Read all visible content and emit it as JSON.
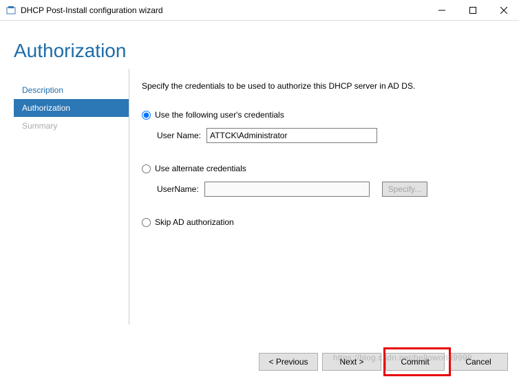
{
  "titlebar": {
    "title": "DHCP Post-Install configuration wizard"
  },
  "header": {
    "title": "Authorization"
  },
  "sidebar": {
    "items": [
      {
        "label": "Description"
      },
      {
        "label": "Authorization"
      },
      {
        "label": "Summary"
      }
    ]
  },
  "content": {
    "instruction": "Specify the credentials to be used to authorize this DHCP server in AD DS.",
    "option1": {
      "label": "Use the following user's credentials",
      "field_label": "User Name:",
      "field_value": "ATTCK\\Administrator"
    },
    "option2": {
      "label": "Use alternate credentials",
      "field_label": "UserName:",
      "field_value": "",
      "specify_btn": "Specify..."
    },
    "option3": {
      "label": "Skip AD authorization"
    }
  },
  "footer": {
    "previous": "< Previous",
    "next": "Next >",
    "commit": "Commit",
    "cancel": "Cancel"
  },
  "watermark": "https://blog.csdn.net/helloworld9998"
}
